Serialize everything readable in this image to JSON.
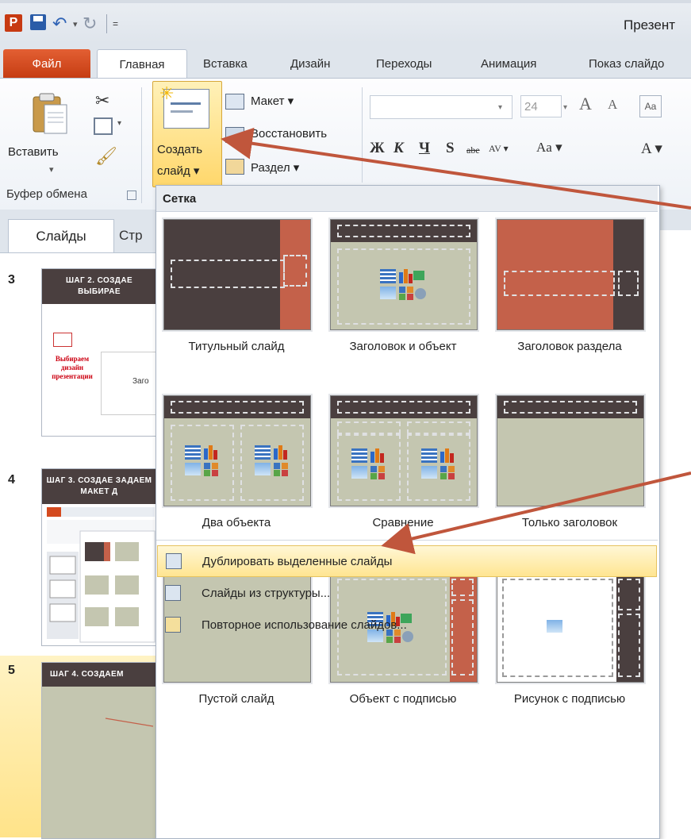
{
  "qat": {
    "app_letter": "P",
    "undo_drop": "▾",
    "customize": "="
  },
  "window": {
    "title": "Презент"
  },
  "tabs": {
    "file": "Файл",
    "home": "Главная",
    "insert": "Вставка",
    "design": "Дизайн",
    "transitions": "Переходы",
    "animation": "Анимация",
    "slideshow": "Показ слайдо"
  },
  "ribbon": {
    "clipboard": {
      "paste": "Вставить",
      "group_label": "Буфер обмена",
      "paste_drop": "▾",
      "copy_drop": "▾"
    },
    "slides": {
      "new_slide_line1": "Создать",
      "new_slide_line2": "слайд ▾",
      "layout": "Макет ▾",
      "reset": "Восстановить",
      "section": "Раздел ▾"
    },
    "font": {
      "size": "24",
      "drop": "▾",
      "grow": "A",
      "shrink": "A",
      "clear": "Aa",
      "bold": "Ж",
      "italic": "К",
      "underline": "Ч",
      "shadow": "S",
      "strike": "abe",
      "spacing": "AV ▾",
      "case": "Aa ▾",
      "color": "A ▾"
    }
  },
  "left_pane": {
    "tabs": {
      "slides": "Слайды",
      "structure": "Стр"
    },
    "slides": [
      {
        "number": "3",
        "header": "ШАГ 2. СОЗДАЕ ВЫБИРАЕ",
        "caption": "Выбираем дизайн презентации",
        "box_label": "Заго"
      },
      {
        "number": "4",
        "header": "ШАГ 3. СОЗДАЕ ЗАДАЕМ МАКЕТ Д"
      },
      {
        "number": "5",
        "header": "ШАГ 4. СОЗДАЕМ"
      }
    ]
  },
  "gallery": {
    "title": "Сетка",
    "layouts": [
      {
        "label": "Титульный слайд"
      },
      {
        "label": "Заголовок и объект"
      },
      {
        "label": "Заголовок раздела"
      },
      {
        "label": "Два объекта"
      },
      {
        "label": "Сравнение"
      },
      {
        "label": "Только заголовок"
      },
      {
        "label": "Пустой слайд"
      },
      {
        "label": "Объект с подписью"
      },
      {
        "label": "Рисунок с подписью"
      }
    ],
    "menu": [
      {
        "label": "Дублировать выделенные слайды"
      },
      {
        "label": "Слайды из структуры..."
      },
      {
        "label": "Повторное использование слайдов..."
      }
    ]
  },
  "colors": {
    "accent_dark": "#4a3f3f",
    "accent_red": "#c4614a",
    "placeholder_green": "#c4c6b0",
    "file_tab": "#d44a1f",
    "highlight": "#ffe389"
  },
  "icons": [
    "app-icon",
    "save-icon",
    "undo-icon",
    "redo-icon",
    "paste-icon",
    "cut-icon",
    "copy-icon",
    "format-painter-icon",
    "new-slide-icon",
    "layout-icon",
    "reset-icon",
    "section-icon",
    "grow-font-icon",
    "shrink-font-icon",
    "clear-format-icon"
  ]
}
